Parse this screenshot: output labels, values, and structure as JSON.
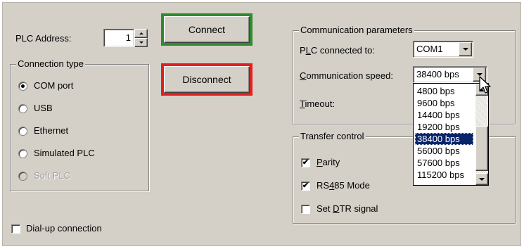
{
  "plc_address": {
    "label": "PLC Address:",
    "value": "1"
  },
  "buttons": {
    "connect": {
      "label": "Connect",
      "frame_color": "#2e8b2e"
    },
    "disconnect": {
      "label": "Disconnect",
      "frame_color": "#e02020"
    }
  },
  "connection_type": {
    "title": "Connection type",
    "options": [
      {
        "label": "COM port",
        "checked": true,
        "enabled": true
      },
      {
        "label": "USB",
        "checked": false,
        "enabled": true
      },
      {
        "label": "Ethernet",
        "checked": false,
        "enabled": true
      },
      {
        "label": "Simulated PLC",
        "checked": false,
        "enabled": true
      },
      {
        "label": "Soft PLC",
        "checked": false,
        "enabled": false
      }
    ]
  },
  "dialup": {
    "label": "Dial-up connection",
    "checked": false
  },
  "comm_params": {
    "title": "Communication parameters",
    "plc_connected_to": {
      "label_prefix": "P",
      "label_accel": "L",
      "label_rest": "C connected to:",
      "value": "COM1"
    },
    "speed": {
      "label_accel": "C",
      "label_rest": "ommunication speed:",
      "value": "38400 bps",
      "options": [
        "4800 bps",
        "9600 bps",
        "14400 bps",
        "19200 bps",
        "38400 bps",
        "56000 bps",
        "57600 bps",
        "115200 bps"
      ],
      "selected_index": 4
    },
    "timeout": {
      "label_accel": "T",
      "label_rest": "imeout:"
    }
  },
  "transfer": {
    "title": "Transfer control",
    "items": [
      {
        "label_accel": "P",
        "label_rest": "arity",
        "checked": true
      },
      {
        "label_pre": "RS",
        "label_accel": "4",
        "label_rest": "85 Mode",
        "checked": true
      },
      {
        "label_pre": "Set ",
        "label_accel": "D",
        "label_rest": "TR signal",
        "checked": false
      }
    ]
  },
  "colors": {
    "dialog_bg": "#d4d0c8",
    "selection": "#0a246a"
  }
}
